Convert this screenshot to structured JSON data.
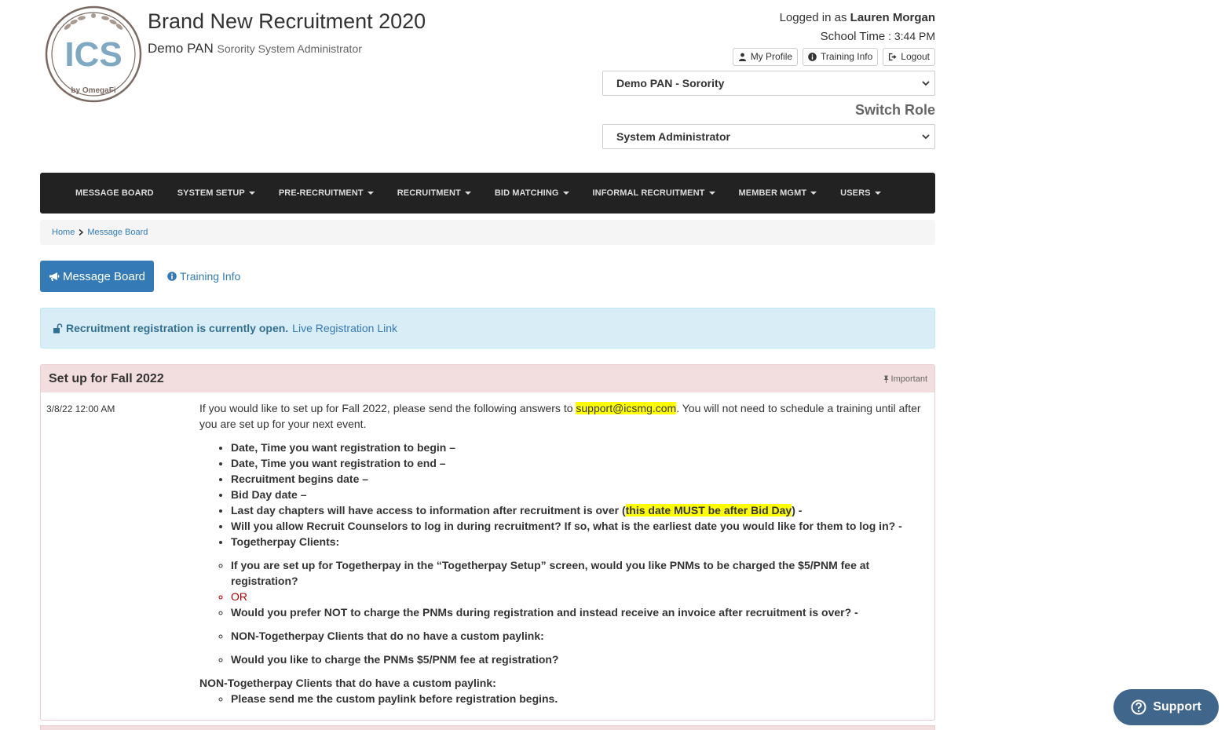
{
  "header": {
    "logo_text": "ICS",
    "logo_sub": "by OmegaFi",
    "app_title": "Brand New Recruitment 2020",
    "org_name": "Demo PAN",
    "org_role": "Sorority System Administrator"
  },
  "user": {
    "logged_in_label": "Logged in as",
    "name": "Lauren Morgan",
    "school_time_label": "School Time",
    "school_time_value": "3:44 PM",
    "buttons": {
      "profile": "My Profile",
      "training": "Training Info",
      "logout": "Logout"
    },
    "org_select_value": "Demo PAN - Sorority",
    "switch_role_label": "Switch Role",
    "role_select_value": "System Administrator"
  },
  "nav": {
    "items": [
      {
        "label": "MESSAGE BOARD",
        "dropdown": false
      },
      {
        "label": "SYSTEM SETUP",
        "dropdown": true
      },
      {
        "label": "PRE-RECRUITMENT",
        "dropdown": true
      },
      {
        "label": "RECRUITMENT",
        "dropdown": true
      },
      {
        "label": "BID MATCHING",
        "dropdown": true
      },
      {
        "label": "INFORMAL RECRUITMENT",
        "dropdown": true
      },
      {
        "label": "MEMBER MGMT",
        "dropdown": true
      },
      {
        "label": "USERS",
        "dropdown": true
      }
    ]
  },
  "breadcrumb": {
    "home": "Home",
    "current": "Message Board"
  },
  "tabs": {
    "message_board": "Message Board",
    "training_info": "Training Info"
  },
  "alert": {
    "status": "Recruitment registration is currently open.",
    "link": "Live Registration Link"
  },
  "post": {
    "title": "Set up for Fall 2022",
    "tag": "Important",
    "date": "3/8/22 12:00 AM",
    "intro_a": "If you would like to set up for Fall 2022, please send the following answers to ",
    "email": "support@icsmg.com",
    "intro_b": ". You will not need to schedule a training until after you are set up for your next event.",
    "items": [
      "Date, Time you want registration to begin –",
      "Date, Time you want registration to end –",
      "Recruitment begins date –",
      "Bid Day date –"
    ],
    "last_day_a": "Last day chapters will have access to information after recruitment is over (",
    "last_day_hl": "this date MUST be after Bid Day",
    "last_day_b": ") -",
    "counselors": "Will you allow Recruit Counselors to log in during recruitment? If so, what is the earliest date you would like for them to log in? -",
    "togetherpay": "Togetherpay Clients:",
    "tp_option_1": "If you are set up for Togetherpay in the “Togetherpay Setup” screen, would you like PNMs to be charged the $5/PNM fee at registration?",
    "tp_or": "OR",
    "tp_option_2": "Would you prefer NOT to charge the PNMs during registration and instead receive an invoice after recruitment is over? -",
    "non_tp_no_link": "NON-Togetherpay Clients that do no have a custom paylink:",
    "charge_q": "Would you like to charge the PNMs $5/PNM fee at registration?",
    "non_tp_link": "NON-Togetherpay Clients that do have a custom paylink:",
    "send_link": "Please send me the custom paylink before registration begins."
  },
  "support": {
    "label": "Support"
  }
}
